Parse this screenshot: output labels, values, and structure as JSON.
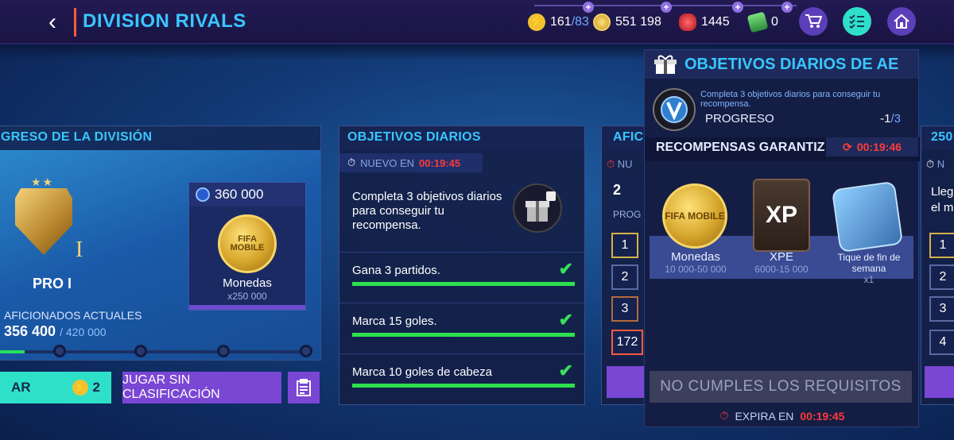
{
  "header": {
    "back_glyph": "‹",
    "title": "DIVISION RIVALS",
    "energy_value": "161",
    "energy_max": "/83",
    "coins": "551 198",
    "gems": "1445",
    "tokens": "0",
    "plus": "+"
  },
  "division_progress": {
    "heading": "GRESO DE LA DIVISIÓN",
    "rank_numeral": "I",
    "rank_name": "PRO I",
    "reward_amount": "360 000",
    "reward_coin_text": "FIFA MOBILE",
    "reward_name": "Monedas",
    "reward_qty": "x250 000",
    "fans_label": "AFICIONADOS ACTUALES",
    "fans_current": "356 400",
    "fans_max": "/ 420 000",
    "fans_progress": 0.1,
    "play_label": "AR",
    "play_count": "2",
    "unranked_label": "JUGAR SIN CLASIFICACIÓN"
  },
  "daily_objectives": {
    "heading": "OBJETIVOS DIARIOS",
    "new_in_label": "NUEVO EN",
    "new_in_time": "00:19:45",
    "description": "Completa 3 objetivos diarios para conseguir tu recompensa.",
    "objectives": [
      {
        "text": "Gana 3 partidos.",
        "done": true
      },
      {
        "text": "Marca 15 goles.",
        "done": true
      },
      {
        "text": "Marca 10 goles de cabeza",
        "done": true
      }
    ]
  },
  "mid_panel": {
    "heading": "AFIC",
    "nu": "NU",
    "count": "2",
    "prog": "PROG",
    "rows": [
      "1",
      "2",
      "3",
      "172"
    ]
  },
  "far_panel": {
    "heading": "250",
    "nu": "N",
    "text1": "Lleg",
    "text2": "el m",
    "rows": [
      "1",
      "2",
      "3",
      "4"
    ]
  },
  "overlay": {
    "title": "OBJETIVOS DIARIOS DE AE",
    "description": "Completa 3 objetivos diarios para conseguir tu recompensa.",
    "progress_label": "PROGRESO",
    "progress_value": "-1",
    "progress_max": "/3",
    "rewards_heading": "RECOMPENSAS GARANTIZ",
    "rewards_timer": "00:19:46",
    "rewards": [
      {
        "name": "Monedas",
        "range": "10 000-50 000",
        "coin_text": "FIFA MOBILE"
      },
      {
        "name": "XPE",
        "range": "6000-15 000",
        "card_text": "XP"
      },
      {
        "name": "Tique de fin de semana",
        "range": "x1"
      }
    ],
    "requirement_button": "NO CUMPLES LOS REQUISITOS",
    "expires_label": "EXPIRA EN",
    "expires_time": "00:19:45"
  },
  "colors": {
    "accent": "#39c6ff",
    "timer": "#ff3b3b",
    "success": "#2ee04f",
    "purple": "#6c4bd0"
  }
}
